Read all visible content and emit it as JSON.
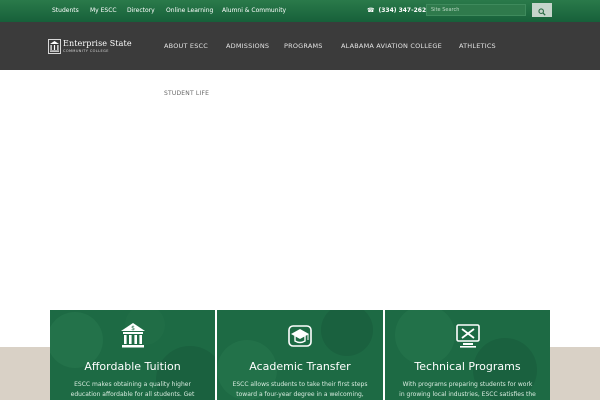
{
  "topbar": {
    "links": [
      "Students",
      "My ESCC",
      "Directory",
      "Online Learning",
      "Alumni & Community"
    ],
    "phone": "(334) 347-2623",
    "search_placeholder": "Site Search"
  },
  "header": {
    "logo_name": "Enterprise State",
    "logo_sub": "COMMUNITY COLLEGE",
    "nav": [
      "ABOUT ESCC",
      "ADMISSIONS",
      "PROGRAMS",
      "ALABAMA AVIATION COLLEGE",
      "ATHLETICS"
    ]
  },
  "breadcrumb": "STUDENT LIFE",
  "cards": [
    {
      "title": "Affordable Tuition",
      "text": "ESCC makes obtaining a quality higher education affordable for all students. Get",
      "icon": "bank-icon"
    },
    {
      "title": "Academic Transfer",
      "text": "ESCC allows students to take their first steps toward a four-year degree in a welcoming,",
      "icon": "graduation-cap-icon"
    },
    {
      "title": "Technical Programs",
      "text": "With programs preparing students for work in growing local industries, ESCC satisfies the",
      "icon": "tools-icon"
    }
  ],
  "colors": {
    "brand_green": "#1d6a44",
    "topbar_green": "#2a7a4a",
    "nav_gray": "#3b3b3b",
    "beige": "#d9d1c6"
  }
}
